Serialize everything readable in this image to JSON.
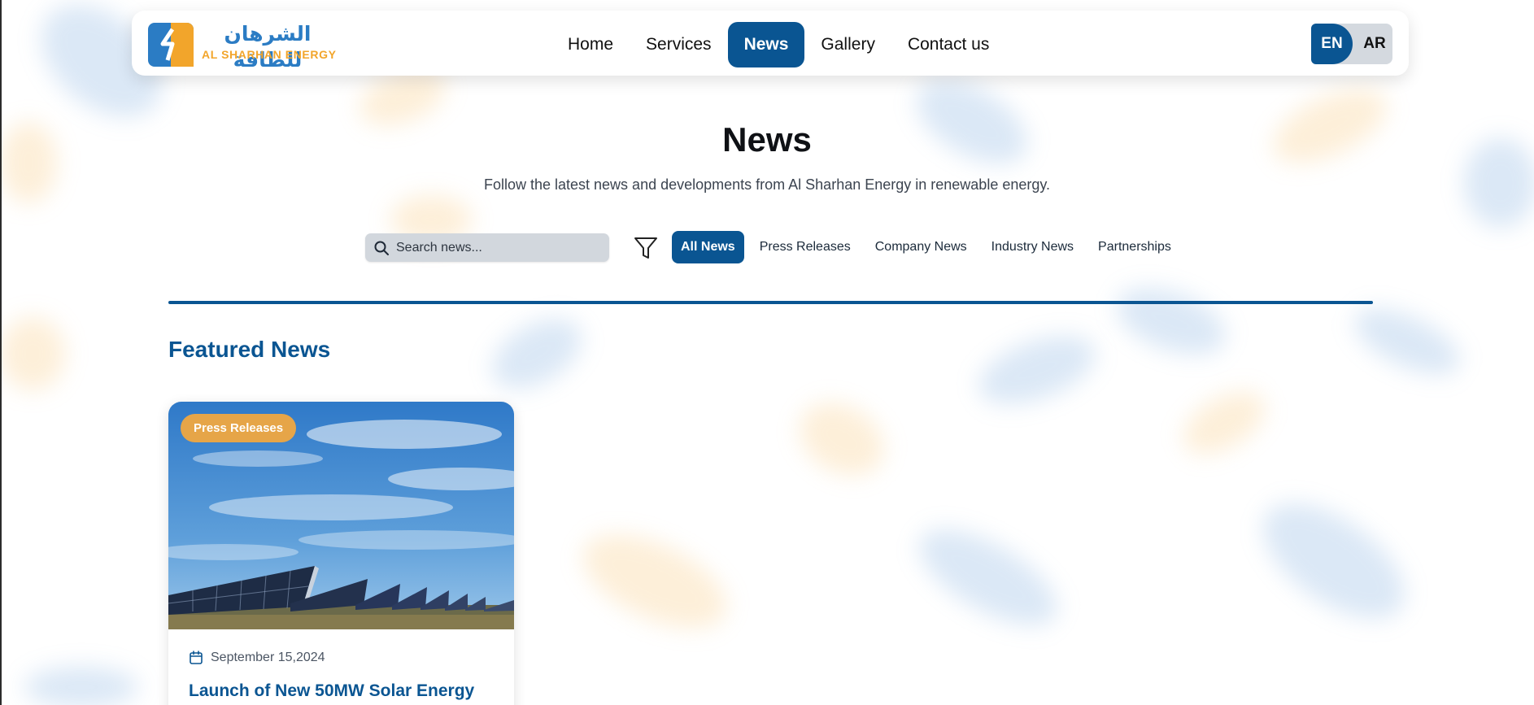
{
  "logo": {
    "arabic_text": "الشرهان للطاقة",
    "english_text": "AL SHARHAN ENERGY",
    "icon": "logo-mark-icon"
  },
  "nav": {
    "items": [
      {
        "label": "Home",
        "active": false
      },
      {
        "label": "Services",
        "active": false
      },
      {
        "label": "News",
        "active": true
      },
      {
        "label": "Gallery",
        "active": false
      },
      {
        "label": "Contact us",
        "active": false
      }
    ]
  },
  "language": {
    "en": "EN",
    "ar": "AR",
    "selected": "EN"
  },
  "hero": {
    "title": "News",
    "subtitle": "Follow the latest news and developments from Al Sharhan Energy in renewable energy."
  },
  "filters": {
    "search_placeholder": "Search news...",
    "search_icon": "search-icon",
    "filter_icon": "filter-icon",
    "categories": [
      {
        "label": "All News",
        "active": true
      },
      {
        "label": "Press Releases",
        "active": false
      },
      {
        "label": "Company News",
        "active": false
      },
      {
        "label": "Industry News",
        "active": false
      },
      {
        "label": "Partnerships",
        "active": false
      }
    ]
  },
  "featured": {
    "section_title": "Featured News",
    "cards": [
      {
        "badge": "Press Releases",
        "date": "September 15,2024",
        "title": "Launch of New 50MW Solar Energy"
      }
    ]
  },
  "colors": {
    "primary": "#0a5592",
    "accent": "#e6a548",
    "logo_blue": "#2b7cc4",
    "logo_orange": "#f2a52b"
  }
}
